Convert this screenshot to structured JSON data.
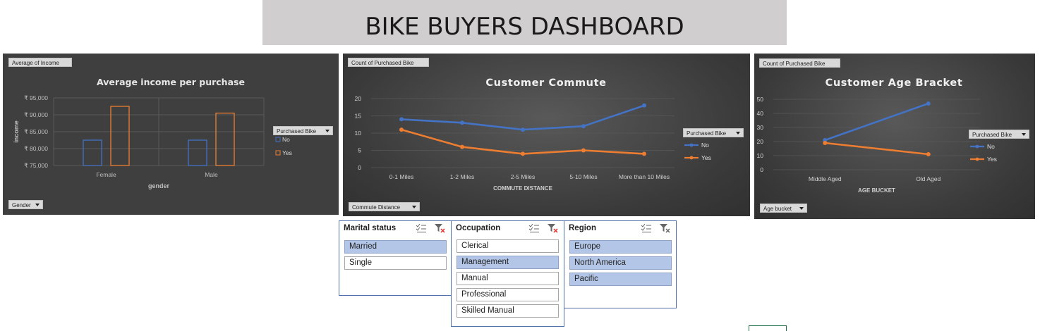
{
  "dashboard_title": "BIKE BUYERS DASHBOARD",
  "colors": {
    "no": "#4472c4",
    "yes": "#ed7d31",
    "panel": "#404040",
    "slicer_selected": "#b4c6e7"
  },
  "chart_data": [
    {
      "type": "bar",
      "title": "Average income per purchase",
      "xlabel": "gender",
      "ylabel": "income",
      "categories": [
        "Female",
        "Male"
      ],
      "series": [
        {
          "name": "No",
          "values": [
            82500,
            82500
          ]
        },
        {
          "name": "Yes",
          "values": [
            92500,
            90500
          ]
        }
      ],
      "ylim": [
        75000,
        95000
      ],
      "yticks": [
        "₹ 75,000",
        "₹ 80,000",
        "₹ 85,000",
        "₹ 90,000",
        "₹ 95,000"
      ],
      "ytick_values": [
        75000,
        80000,
        85000,
        90000,
        95000
      ],
      "value_field": "Average of Income",
      "axis_field": "Gender",
      "legend_field": "Purchased Bike",
      "legend_items": [
        "No",
        "Yes"
      ],
      "legend_position": "right",
      "grid": true
    },
    {
      "type": "line",
      "title": "Customer Commute",
      "xlabel": "COMMUTE DISTANCE",
      "ylabel": "",
      "categories": [
        "0-1 Miles",
        "1-2 Miles",
        "2-5 Miles",
        "5-10 Miles",
        "More than 10 Miles"
      ],
      "series": [
        {
          "name": "No",
          "values": [
            14,
            13,
            11,
            12,
            18
          ]
        },
        {
          "name": "Yes",
          "values": [
            11,
            6,
            4,
            5,
            4
          ]
        }
      ],
      "ylim": [
        0,
        20
      ],
      "yticks": [
        "0",
        "5",
        "10",
        "15",
        "20"
      ],
      "ytick_values": [
        0,
        5,
        10,
        15,
        20
      ],
      "value_field": "Count of Purchased Bike",
      "axis_field": "Commute Distance",
      "legend_field": "Purchased Bike",
      "legend_items": [
        "No",
        "Yes"
      ],
      "legend_position": "right",
      "grid": true
    },
    {
      "type": "line",
      "title": "Customer Age Bracket",
      "xlabel": "AGE BUCKET",
      "ylabel": "",
      "categories": [
        "Middle Aged",
        "Old Aged"
      ],
      "series": [
        {
          "name": "No",
          "values": [
            21,
            47
          ]
        },
        {
          "name": "Yes",
          "values": [
            19,
            11
          ]
        }
      ],
      "ylim": [
        0,
        50
      ],
      "yticks": [
        "0",
        "10",
        "20",
        "30",
        "40",
        "50"
      ],
      "ytick_values": [
        0,
        10,
        20,
        30,
        40,
        50
      ],
      "value_field": "Count of Purchased Bike",
      "axis_field": "Age bucket",
      "legend_field": "Purchased Bike",
      "legend_items": [
        "No",
        "Yes"
      ],
      "legend_position": "right",
      "grid": true
    }
  ],
  "slicers": [
    {
      "title": "Marital status",
      "items": [
        {
          "label": "Married",
          "selected": true
        },
        {
          "label": "Single",
          "selected": false
        }
      ]
    },
    {
      "title": "Occupation",
      "items": [
        {
          "label": "Clerical",
          "selected": false
        },
        {
          "label": "Management",
          "selected": true
        },
        {
          "label": "Manual",
          "selected": false
        },
        {
          "label": "Professional",
          "selected": false
        },
        {
          "label": "Skilled Manual",
          "selected": false
        }
      ]
    },
    {
      "title": "Region",
      "items": [
        {
          "label": "Europe",
          "selected": true
        },
        {
          "label": "North America",
          "selected": true
        },
        {
          "label": "Pacific",
          "selected": true
        }
      ]
    }
  ]
}
